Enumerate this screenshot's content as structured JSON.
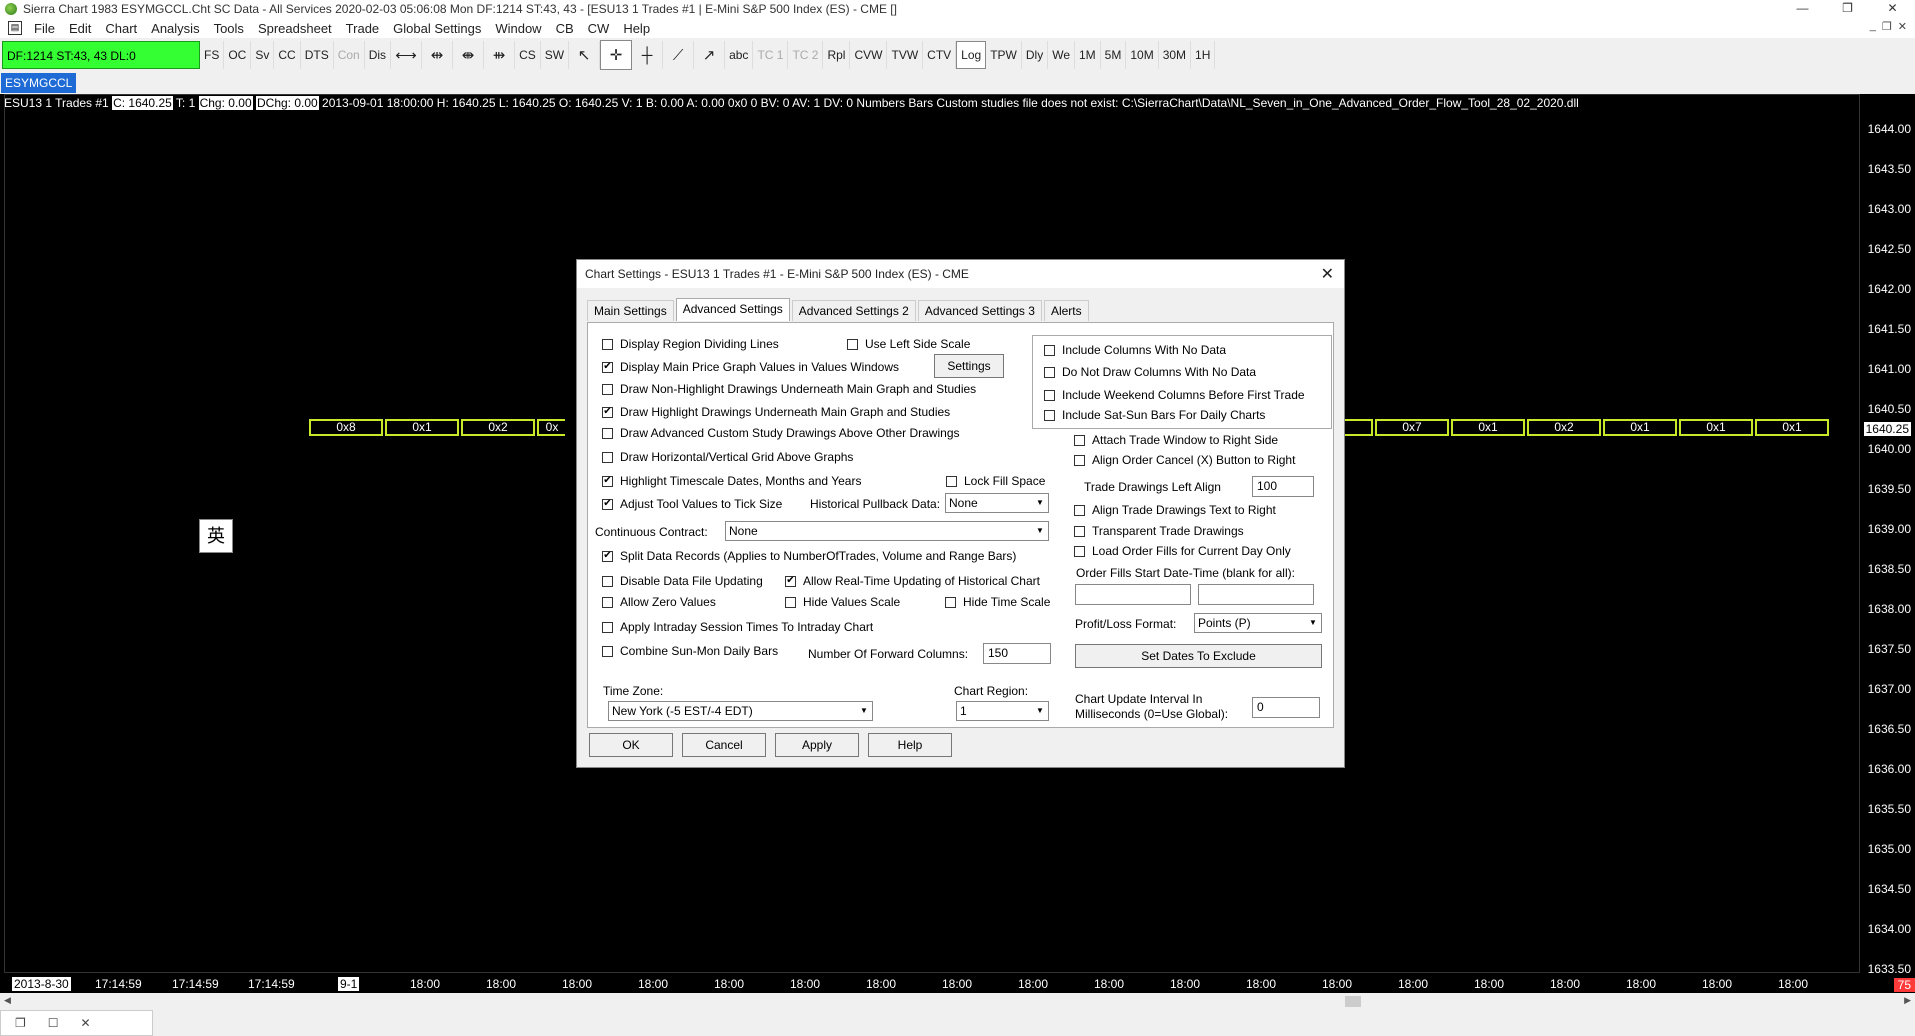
{
  "window": {
    "title": "Sierra Chart 1983 ESYMGCCL.Cht  SC Data - All Services 2020-02-03  05:06:08 Mon  DF:1214  ST:43, 43 - [ESU13  1 Trades  #1 | E-Mini S&P 500 Index (ES) - CME []",
    "controls": [
      "—",
      "❐",
      "✕"
    ]
  },
  "menu": {
    "items": [
      "File",
      "Edit",
      "Chart",
      "Analysis",
      "Tools",
      "Spreadsheet",
      "Trade",
      "Global Settings",
      "Window",
      "CB",
      "CW",
      "Help"
    ],
    "mdi_controls": [
      "_",
      "❐",
      "✕"
    ]
  },
  "toolbar": {
    "status": "DF:1214  ST:43, 43  DL:0",
    "buttons_a": [
      "FS",
      "OC",
      "Sv",
      "CC",
      "DTS",
      "Con",
      "Dis"
    ],
    "buttons_b": [
      "CS",
      "SW"
    ],
    "buttons_c": [
      "abc",
      "TC 1",
      "TC 2",
      "Rpl",
      "CVW",
      "TVW",
      "CTV",
      "Log",
      "TPW",
      "Dly",
      "We",
      "1M",
      "5M",
      "10M",
      "30M",
      "1H"
    ],
    "icons": [
      "↤↦",
      "⇹",
      "⇼",
      "⇻",
      "⇺",
      "pointer",
      "crosshair",
      "cross",
      "line",
      "ray"
    ]
  },
  "chart_tab": "ESYMGCCL",
  "info_line": {
    "symbol": "ESU13  1 Trades  #1 ",
    "close": "C: 1640.25",
    "t": " T: 1 ",
    "chg": "Chg: 0.00",
    "dchg": "DChg: 0.00",
    "rest": " 2013-09-01 18:00:00 H: 1640.25 L: 1640.25 O: 1640.25 V: 1 B: 0.00 A: 0.00 0x0 0 BV: 0 AV: 1 DV: 0 Numbers Bars  Custom studies file does not exist: C:\\SierraChart\\Data\\NL_Seven_in_One_Advanced_Order_Flow_Tool_28_02_2020.dll"
  },
  "price_axis": {
    "ticks": [
      "1644.00",
      "1643.50",
      "1643.00",
      "1642.50",
      "1642.00",
      "1641.50",
      "1641.00",
      "1640.50",
      "1640.00",
      "1639.50",
      "1639.00",
      "1638.50",
      "1638.00",
      "1637.50",
      "1637.00",
      "1636.50",
      "1636.00",
      "1635.50",
      "1635.00",
      "1634.50",
      "1634.00",
      "1633.50"
    ],
    "current_price": "1640.25",
    "corner_value": "75"
  },
  "numbers_bars": {
    "left": [
      "0x8",
      "0x1",
      "0x2",
      "0x"
    ],
    "right": [
      "0x7",
      "0x1",
      "0x2",
      "0x1",
      "0x1",
      "0x1"
    ]
  },
  "ime_glyph": "英",
  "time_axis": {
    "labels": [
      "2013-8-30",
      "17:14:59",
      "17:14:59",
      "17:14:59",
      "9-1",
      "18:00",
      "18:00",
      "18:00",
      "18:00",
      "18:00",
      "18:00",
      "18:00",
      "18:00",
      "18:00",
      "18:00",
      "18:00",
      "18:00",
      "18:00",
      "18:00",
      "18:00",
      "18:00",
      "18:00",
      "18:00",
      "18:00"
    ]
  },
  "dialog": {
    "title": "Chart Settings - ESU13  1 Trades  #1 - E-Mini S&P 500 Index (ES) - CME",
    "close": "✕",
    "tabs": [
      "Main Settings",
      "Advanced Settings",
      "Advanced Settings 2",
      "Advanced Settings 3",
      "Alerts"
    ],
    "active_tab": 1,
    "left_checks": [
      {
        "label": "Display Region Dividing Lines",
        "checked": false
      },
      {
        "label": "Display Main Price Graph Values in Values Windows",
        "checked": true
      },
      {
        "label": "Draw Non-Highlight Drawings Underneath Main Graph and Studies",
        "checked": false
      },
      {
        "label": "Draw Highlight Drawings Underneath Main Graph and Studies",
        "checked": true
      },
      {
        "label": "Draw Advanced Custom Study Drawings Above Other Drawings",
        "checked": false
      },
      {
        "label": "Draw Horizontal/Vertical Grid Above Graphs",
        "checked": false
      },
      {
        "label": "Highlight Timescale Dates, Months and Years",
        "checked": true
      },
      {
        "label": "Adjust Tool Values to Tick Size",
        "checked": true
      },
      {
        "label": "Split Data Records (Applies to NumberOfTrades, Volume and Range Bars)",
        "checked": true
      },
      {
        "label": "Disable Data File Updating",
        "checked": false
      },
      {
        "label": "Allow Zero Values",
        "checked": false
      },
      {
        "label": "Apply Intraday Session Times To Intraday Chart",
        "checked": false
      },
      {
        "label": "Combine Sun-Mon Daily Bars",
        "checked": false
      }
    ],
    "use_left_side_scale": {
      "label": "Use Left Side Scale",
      "checked": false
    },
    "settings_button": "Settings",
    "lock_fill_space": {
      "label": "Lock Fill Space",
      "checked": false
    },
    "historical_pullback": {
      "label": "Historical Pullback Data:",
      "value": "None"
    },
    "continuous_contract": {
      "label": "Continuous Contract:",
      "value": "None"
    },
    "allow_realtime": {
      "label": "Allow Real-Time Updating of Historical Chart",
      "checked": true
    },
    "hide_values_scale": {
      "label": "Hide Values Scale",
      "checked": false
    },
    "hide_time_scale": {
      "label": "Hide Time Scale",
      "checked": false
    },
    "forward_columns": {
      "label": "Number Of Forward Columns:",
      "value": "150"
    },
    "time_zone": {
      "label": "Time Zone:",
      "value": "New York (-5 EST/-4 EDT)"
    },
    "chart_region": {
      "label": "Chart Region:",
      "value": "1"
    },
    "group_checks": [
      {
        "label": "Include Columns With No Data",
        "checked": false
      },
      {
        "label": "Do Not Draw Columns With No Data",
        "checked": false
      },
      {
        "label": "Include Weekend Columns Before First Trade",
        "checked": false
      },
      {
        "label": "Include Sat-Sun Bars For Daily Charts",
        "checked": false
      }
    ],
    "right_checks_a": [
      {
        "label": "Attach Trade Window to Right Side",
        "checked": false
      },
      {
        "label": "Align Order Cancel (X) Button to Right",
        "checked": false
      }
    ],
    "trade_drawings_left_align": {
      "label": "Trade Drawings Left Align",
      "value": "100"
    },
    "right_checks_b": [
      {
        "label": "Align Trade Drawings Text to Right",
        "checked": false
      },
      {
        "label": "Transparent Trade Drawings",
        "checked": false
      },
      {
        "label": "Load Order Fills for Current Day Only",
        "checked": false
      }
    ],
    "order_fills_start": {
      "label": "Order Fills Start Date-Time (blank for all):",
      "date": "",
      "time": ""
    },
    "profit_loss": {
      "label": "Profit/Loss Format:",
      "value": "Points (P)"
    },
    "set_dates_button": "Set Dates To Exclude",
    "update_interval": {
      "label_1": "Chart Update Interval In",
      "label_2": "Milliseconds (0=Use Global):",
      "value": "0"
    },
    "footer": {
      "ok": "OK",
      "cancel": "Cancel",
      "apply": "Apply",
      "help": "Help"
    }
  }
}
